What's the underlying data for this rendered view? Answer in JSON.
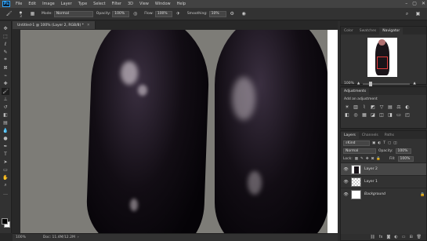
{
  "menu": {
    "logo": "Ps",
    "items": [
      "File",
      "Edit",
      "Image",
      "Layer",
      "Type",
      "Select",
      "Filter",
      "3D",
      "View",
      "Window",
      "Help"
    ],
    "window_controls": [
      "–",
      "▢",
      "✕"
    ]
  },
  "options": {
    "brush_size": "3",
    "mode_label": "Mode:",
    "mode_value": "Normal",
    "opacity_label": "Opacity:",
    "opacity_value": "100%",
    "flow_label": "Flow:",
    "flow_value": "100%",
    "smoothing_label": "Smoothing:",
    "smoothing_value": "10%"
  },
  "document": {
    "tab_title": "Untitled-1 @ 100% (Layer 2, RGB/8) *",
    "zoom": "100%",
    "doc_info": "Doc: 11.4M/12.2M"
  },
  "navigator": {
    "tabs": [
      "Color",
      "Swatches",
      "Navigator"
    ],
    "active_tab": "Navigator",
    "zoom": "100%"
  },
  "adjustments": {
    "tab": "Adjustments",
    "title": "Add an adjustment"
  },
  "layers": {
    "tabs": [
      "Layers",
      "Channels",
      "Paths"
    ],
    "active_tab": "Layers",
    "filter_label": "Kind",
    "blend_mode": "Normal",
    "opacity_label": "Opacity:",
    "opacity_value": "100%",
    "lock_label": "Lock:",
    "fill_label": "Fill:",
    "fill_value": "100%",
    "items": [
      {
        "name": "Layer 2",
        "selected": true
      },
      {
        "name": "Layer 1",
        "selected": false
      },
      {
        "name": "Background",
        "selected": false
      }
    ]
  },
  "colors": {
    "accent": "#31a8ff",
    "foreground": "#000000",
    "background": "#ffffff"
  }
}
